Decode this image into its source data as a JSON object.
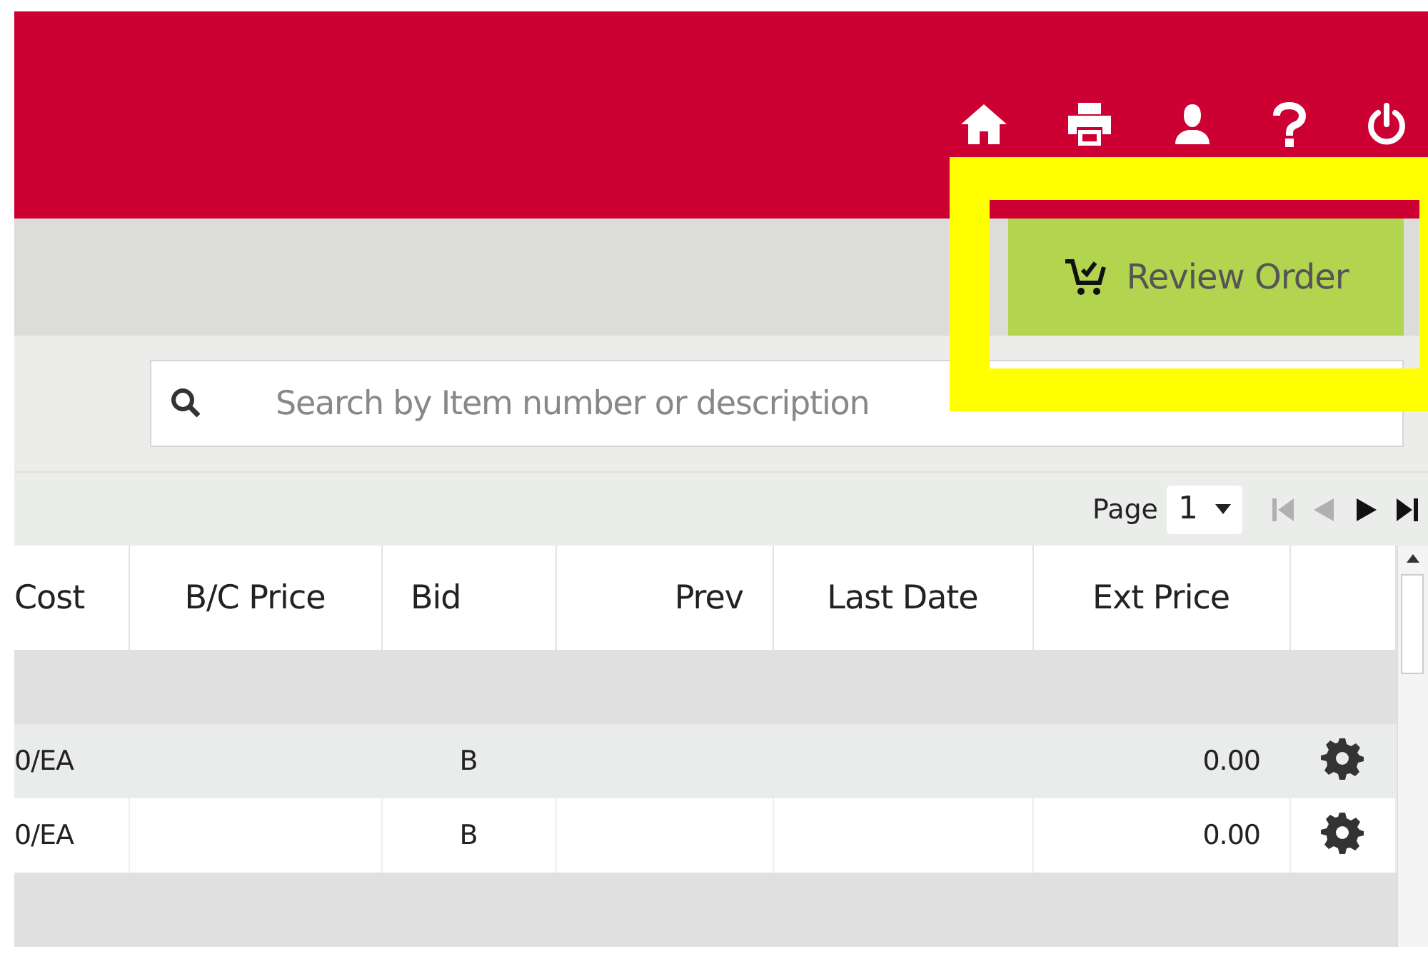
{
  "header": {
    "icons": [
      {
        "kind": "home"
      },
      {
        "kind": "print"
      },
      {
        "kind": "user"
      },
      {
        "kind": "help"
      },
      {
        "kind": "power"
      }
    ]
  },
  "toolbar": {
    "review_button": "Review Order"
  },
  "search": {
    "placeholder": "Search by Item number or description"
  },
  "pager": {
    "label": "Page",
    "page": "1",
    "buttons": [
      {
        "kind": "first",
        "disabled": true
      },
      {
        "kind": "prev",
        "disabled": true
      },
      {
        "kind": "next",
        "disabled": false
      },
      {
        "kind": "last",
        "disabled": false
      }
    ]
  },
  "table": {
    "columns": [
      {
        "label": "Cost"
      },
      {
        "label": "B/C Price"
      },
      {
        "label": "Bid"
      },
      {
        "label": "Prev"
      },
      {
        "label": "Last Date"
      },
      {
        "label": "Ext Price"
      }
    ],
    "rows": [
      {
        "kind": "group"
      },
      {
        "kind": "item",
        "cost": "0/EA",
        "bid": "B",
        "ext_price": "0.00"
      },
      {
        "kind": "item",
        "cost": "0/EA",
        "bid": "B",
        "ext_price": "0.00"
      },
      {
        "kind": "group"
      }
    ]
  }
}
